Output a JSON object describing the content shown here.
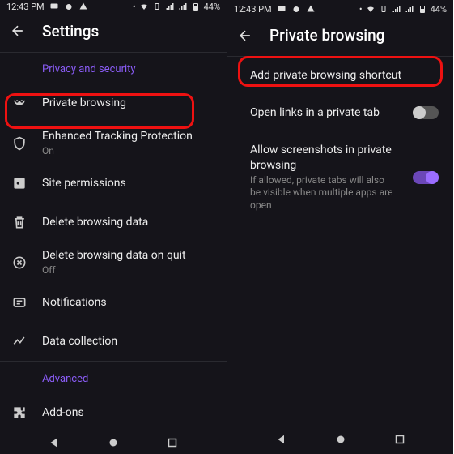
{
  "status": {
    "time": "12:43 PM",
    "battery": "44%"
  },
  "left": {
    "title": "Settings",
    "section1": "Privacy and security",
    "items": [
      {
        "label": "Private browsing",
        "sub": ""
      },
      {
        "label": "Enhanced Tracking Protection",
        "sub": "On"
      },
      {
        "label": "Site permissions",
        "sub": ""
      },
      {
        "label": "Delete browsing data",
        "sub": ""
      },
      {
        "label": "Delete browsing data on quit",
        "sub": "Off"
      },
      {
        "label": "Notifications",
        "sub": ""
      },
      {
        "label": "Data collection",
        "sub": ""
      }
    ],
    "section2": "Advanced",
    "addons": "Add-ons"
  },
  "right": {
    "title": "Private browsing",
    "items": [
      {
        "label": "Add private browsing shortcut",
        "sub": ""
      },
      {
        "label": "Open links in a private tab",
        "sub": ""
      },
      {
        "label": "Allow screenshots in private browsing",
        "sub": "If allowed, private tabs will also be visible when multiple apps are open"
      }
    ]
  }
}
